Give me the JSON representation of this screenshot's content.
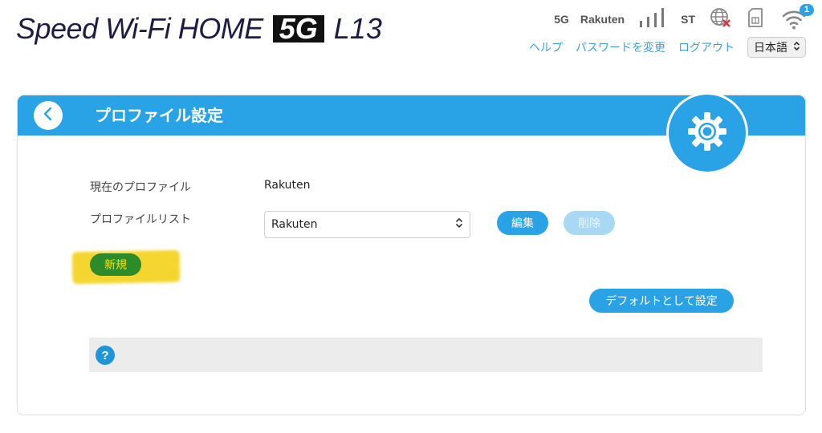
{
  "brand": {
    "name": "Speed Wi-Fi HOME",
    "badge": "5G",
    "model": "L13"
  },
  "status": {
    "network": "5G",
    "carrier": "Rakuten",
    "sim_state": "ST",
    "wifi_count": "1",
    "icons": [
      "signal-bars-icon",
      "globe-disconnected-icon",
      "sim-card-icon",
      "wifi-icon"
    ]
  },
  "nav": {
    "help": "ヘルプ",
    "change_password": "パスワードを変更",
    "logout": "ログアウト",
    "language": "日本語"
  },
  "page": {
    "title": "プロファイル設定"
  },
  "form": {
    "current_profile_label": "現在のプロファイル",
    "current_profile_value": "Rakuten",
    "profile_list_label": "プロファイルリスト",
    "profile_list_selected": "Rakuten",
    "edit_label": "編集",
    "delete_label": "削除",
    "new_label": "新規",
    "set_default_label": "デフォルトとして設定"
  },
  "help": {
    "icon": "?"
  },
  "colors": {
    "accent": "#29a3e6",
    "new_button_bg": "#2e8b2a",
    "highlight": "#f4d21a",
    "disabled": "#a8d8f3"
  }
}
